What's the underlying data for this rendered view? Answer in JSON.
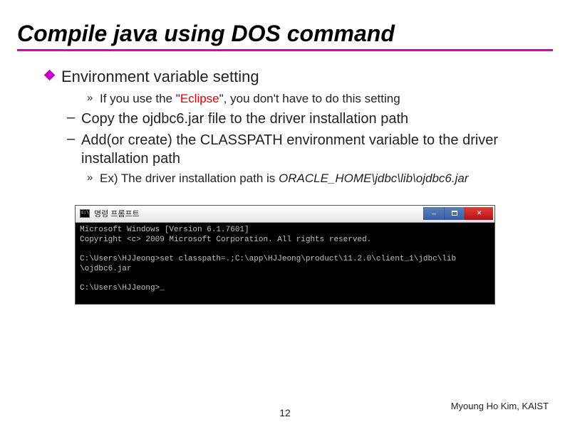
{
  "title": "Compile java using DOS command",
  "bullets": {
    "item1": "Environment variable setting",
    "item1a_pre": "If you use the \"",
    "item1a_emph": "Eclipse",
    "item1a_post": "\", you don't have to do this setting",
    "item1b": "Copy the ojdbc6.jar file to the driver installation path",
    "item1c": "Add(or create) the CLASSPATH environment variable to the driver installation path",
    "item1c_ex_pre": "Ex) The driver installation path is ",
    "item1c_ex_italic": "ORACLE_HOME\\jdbc\\lib\\ojdbc6.jar"
  },
  "terminal": {
    "title": "명령 프롬프트",
    "line1": "Microsoft Windows [Version 6.1.7601]",
    "line2": "Copyright <c> 2009 Microsoft Corporation. All rights reserved.",
    "blank": "",
    "line3": "C:\\Users\\HJJeong>set classpath=.;C:\\app\\HJJeong\\product\\11.2.0\\client_1\\jdbc\\lib",
    "line4": "\\ojdbc6.jar",
    "line5": "C:\\Users\\HJJeong>"
  },
  "footer": {
    "page": "12",
    "author": "Myoung Ho Kim, KAIST"
  }
}
